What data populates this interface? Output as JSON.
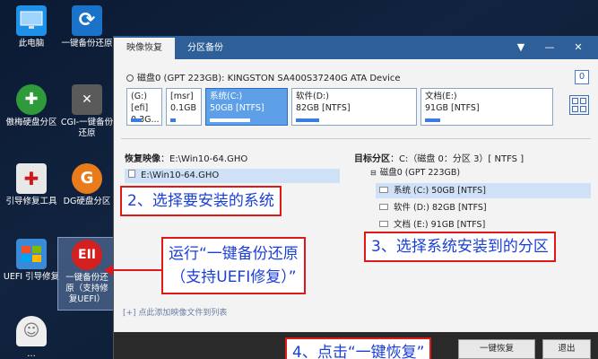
{
  "desktop": {
    "icons": [
      {
        "label": "此电脑",
        "icon": "monitor-icon"
      },
      {
        "label": "一键备份还原",
        "icon": "refresh-icon"
      },
      {
        "label": "傲梅硬盘分区",
        "icon": "pie-disk-icon"
      },
      {
        "label": "CGI-一键备份还原",
        "icon": "cgi-tools-icon"
      },
      {
        "label": "引导修复工具",
        "icon": "medical-kit-icon"
      },
      {
        "label": "DG硬盘分区",
        "icon": "dg-logo-icon"
      },
      {
        "label": "UEFI 引导修复",
        "icon": "uefi-window-icon"
      },
      {
        "label": "一键备份还原（支持修复UEFI）",
        "icon": "eii-logo-icon",
        "badge": "EII"
      },
      {
        "label": "…",
        "icon": "ghost-icon"
      }
    ]
  },
  "window": {
    "tabs": [
      "映像恢复",
      "分区备份"
    ],
    "controls": {
      "menu": "▼",
      "minimize": "—",
      "close": "✕"
    },
    "disk": {
      "title": "磁盘0 (GPT 223GB): KINGSTON SA400S37240G ATA Device",
      "badge": "0",
      "partitions": [
        {
          "name": "(G:)[efi]",
          "size": "0.3G...",
          "fill": 0.4
        },
        {
          "name": "[msr]",
          "size": "0.1GB",
          "fill": 0.2
        },
        {
          "name": "系统(C:)",
          "size": "50GB [NTFS]",
          "fill": 0.55,
          "selected": true
        },
        {
          "name": "软件(D:)",
          "size": "82GB [NTFS]",
          "fill": 0.2
        },
        {
          "name": "文档(E:)",
          "size": "91GB [NTFS]",
          "fill": 0.12
        }
      ]
    },
    "restore_image_label": "恢复映像",
    "restore_image_path": "：E:\\Win10-64.GHO",
    "image_selected": "E:\\Win10-64.GHO",
    "target_label": "目标分区",
    "target_value": "：C:（磁盘 0：分区 3）[ NTFS ]",
    "tree_root": "磁盘0 (GPT 223GB)",
    "tree_items": [
      {
        "label": "系统 (C:) 50GB [NTFS]",
        "selected": true
      },
      {
        "label": "软件 (D:) 82GB [NTFS]",
        "selected": false
      },
      {
        "label": "文档 (E:) 91GB [NTFS]",
        "selected": false
      }
    ],
    "add_image_link": "[+] 点此添加映像文件到列表",
    "buttons": {
      "restore": "一键恢复",
      "exit": "退出"
    }
  },
  "annotations": {
    "step2": "2、选择要安装的系统",
    "step3": "3、选择系统安装到的分区",
    "step4": "4、点击“一键恢复”",
    "run_line1": "运行“一键备份还原",
    "run_line2": "（支持UEFI修复）”"
  },
  "colors": {
    "accent": "#2f5f98",
    "annotation_border": "#e01818",
    "annotation_text": "#1a3fd6",
    "selection": "#cfe1f7"
  }
}
